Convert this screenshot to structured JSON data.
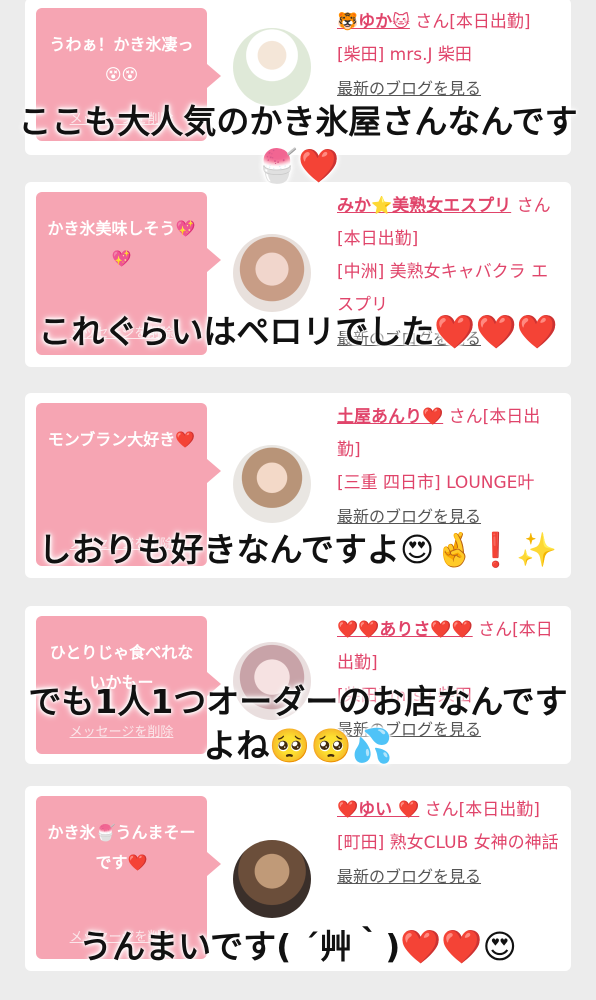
{
  "cards": [
    {
      "message": "うわぁ！かき氷凄っ😵😵",
      "delete_label": "メッセージを削除",
      "name": "🐯ゆか🐱",
      "name_suffix": "さん[本日出勤]",
      "shop": "[柴田] mrs.J 柴田",
      "blog": "最新のブログを見る"
    },
    {
      "message": "かき氷美味しそう💖💖",
      "delete_label": "メッセージを削除",
      "name": "みか⭐美熟女エスプリ",
      "name_suffix": "さん[本日出勤]",
      "shop": "[中洲] 美熟女キャバクラ エスプリ",
      "blog": "最新のブログを見る"
    },
    {
      "message": "モンブラン大好き❤️",
      "delete_label": "メッセージを削除",
      "name": "土屋あんり❤️",
      "name_suffix": "さん[本日出勤]",
      "shop": "[三重 四日市] LOUNGE叶",
      "blog": "最新のブログを見る"
    },
    {
      "message": "ひとりじゃ食べれないかもー",
      "delete_label": "メッセージを削除",
      "name": "❤️❤️ありさ❤️❤️",
      "name_suffix": "さん[本日出勤]",
      "shop": "[柴田] mrs.J 柴田",
      "blog": "最新のブログを見る"
    },
    {
      "message": "かき氷🍧うんまそーです❤️",
      "delete_label": "メッセージを削除",
      "name": "❤️ゆい ❤️",
      "name_suffix": "さん[本日出勤]",
      "shop": "[町田] 熟女CLUB 女神の神話",
      "blog": "最新のブログを見る"
    }
  ],
  "overlays": [
    "ここも大人気のかき氷屋さんなんです🍧❤️",
    "これぐらいはペロリでした❤️❤️❤️",
    "しおりも好きなんですよ😍🤞❗✨",
    "でも1人1つオーダーのお店なんですよね🥺🥺💦",
    "うんまいです( ´艸｀)❤️❤️😍"
  ],
  "colors": {
    "bubble": "#f6a5b3",
    "accent": "#e0446a",
    "background": "#ececec"
  }
}
